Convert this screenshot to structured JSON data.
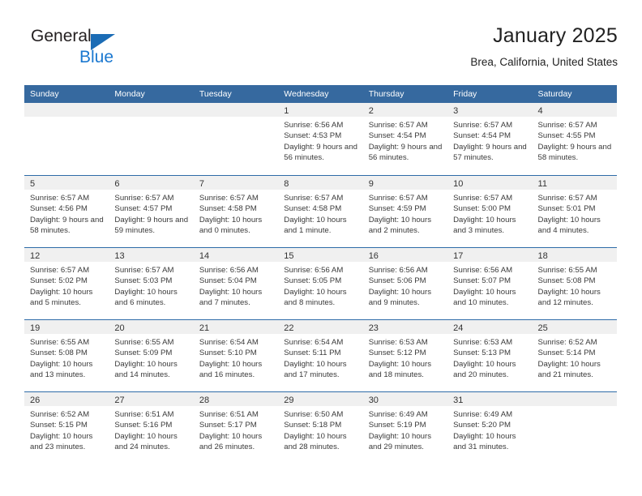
{
  "brand": {
    "name_part1": "General",
    "name_part2": "Blue",
    "accent_color": "#1b6cb5",
    "blue_text_color": "#1b78d0"
  },
  "header": {
    "title": "January 2025",
    "subtitle": "Brea, California, United States",
    "header_bg_color": "#36699f",
    "row_divider_color": "#2e6ca8",
    "day_band_color": "#f0f0f0"
  },
  "weekdays": [
    "Sunday",
    "Monday",
    "Tuesday",
    "Wednesday",
    "Thursday",
    "Friday",
    "Saturday"
  ],
  "weeks": [
    [
      {
        "day": "",
        "sunrise": "",
        "sunset": "",
        "daylight": "",
        "empty": true
      },
      {
        "day": "",
        "sunrise": "",
        "sunset": "",
        "daylight": "",
        "empty": true
      },
      {
        "day": "",
        "sunrise": "",
        "sunset": "",
        "daylight": "",
        "empty": true
      },
      {
        "day": "1",
        "sunrise": "Sunrise: 6:56 AM",
        "sunset": "Sunset: 4:53 PM",
        "daylight": "Daylight: 9 hours and 56 minutes."
      },
      {
        "day": "2",
        "sunrise": "Sunrise: 6:57 AM",
        "sunset": "Sunset: 4:54 PM",
        "daylight": "Daylight: 9 hours and 56 minutes."
      },
      {
        "day": "3",
        "sunrise": "Sunrise: 6:57 AM",
        "sunset": "Sunset: 4:54 PM",
        "daylight": "Daylight: 9 hours and 57 minutes."
      },
      {
        "day": "4",
        "sunrise": "Sunrise: 6:57 AM",
        "sunset": "Sunset: 4:55 PM",
        "daylight": "Daylight: 9 hours and 58 minutes."
      }
    ],
    [
      {
        "day": "5",
        "sunrise": "Sunrise: 6:57 AM",
        "sunset": "Sunset: 4:56 PM",
        "daylight": "Daylight: 9 hours and 58 minutes."
      },
      {
        "day": "6",
        "sunrise": "Sunrise: 6:57 AM",
        "sunset": "Sunset: 4:57 PM",
        "daylight": "Daylight: 9 hours and 59 minutes."
      },
      {
        "day": "7",
        "sunrise": "Sunrise: 6:57 AM",
        "sunset": "Sunset: 4:58 PM",
        "daylight": "Daylight: 10 hours and 0 minutes."
      },
      {
        "day": "8",
        "sunrise": "Sunrise: 6:57 AM",
        "sunset": "Sunset: 4:58 PM",
        "daylight": "Daylight: 10 hours and 1 minute."
      },
      {
        "day": "9",
        "sunrise": "Sunrise: 6:57 AM",
        "sunset": "Sunset: 4:59 PM",
        "daylight": "Daylight: 10 hours and 2 minutes."
      },
      {
        "day": "10",
        "sunrise": "Sunrise: 6:57 AM",
        "sunset": "Sunset: 5:00 PM",
        "daylight": "Daylight: 10 hours and 3 minutes."
      },
      {
        "day": "11",
        "sunrise": "Sunrise: 6:57 AM",
        "sunset": "Sunset: 5:01 PM",
        "daylight": "Daylight: 10 hours and 4 minutes."
      }
    ],
    [
      {
        "day": "12",
        "sunrise": "Sunrise: 6:57 AM",
        "sunset": "Sunset: 5:02 PM",
        "daylight": "Daylight: 10 hours and 5 minutes."
      },
      {
        "day": "13",
        "sunrise": "Sunrise: 6:57 AM",
        "sunset": "Sunset: 5:03 PM",
        "daylight": "Daylight: 10 hours and 6 minutes."
      },
      {
        "day": "14",
        "sunrise": "Sunrise: 6:56 AM",
        "sunset": "Sunset: 5:04 PM",
        "daylight": "Daylight: 10 hours and 7 minutes."
      },
      {
        "day": "15",
        "sunrise": "Sunrise: 6:56 AM",
        "sunset": "Sunset: 5:05 PM",
        "daylight": "Daylight: 10 hours and 8 minutes."
      },
      {
        "day": "16",
        "sunrise": "Sunrise: 6:56 AM",
        "sunset": "Sunset: 5:06 PM",
        "daylight": "Daylight: 10 hours and 9 minutes."
      },
      {
        "day": "17",
        "sunrise": "Sunrise: 6:56 AM",
        "sunset": "Sunset: 5:07 PM",
        "daylight": "Daylight: 10 hours and 10 minutes."
      },
      {
        "day": "18",
        "sunrise": "Sunrise: 6:55 AM",
        "sunset": "Sunset: 5:08 PM",
        "daylight": "Daylight: 10 hours and 12 minutes."
      }
    ],
    [
      {
        "day": "19",
        "sunrise": "Sunrise: 6:55 AM",
        "sunset": "Sunset: 5:08 PM",
        "daylight": "Daylight: 10 hours and 13 minutes."
      },
      {
        "day": "20",
        "sunrise": "Sunrise: 6:55 AM",
        "sunset": "Sunset: 5:09 PM",
        "daylight": "Daylight: 10 hours and 14 minutes."
      },
      {
        "day": "21",
        "sunrise": "Sunrise: 6:54 AM",
        "sunset": "Sunset: 5:10 PM",
        "daylight": "Daylight: 10 hours and 16 minutes."
      },
      {
        "day": "22",
        "sunrise": "Sunrise: 6:54 AM",
        "sunset": "Sunset: 5:11 PM",
        "daylight": "Daylight: 10 hours and 17 minutes."
      },
      {
        "day": "23",
        "sunrise": "Sunrise: 6:53 AM",
        "sunset": "Sunset: 5:12 PM",
        "daylight": "Daylight: 10 hours and 18 minutes."
      },
      {
        "day": "24",
        "sunrise": "Sunrise: 6:53 AM",
        "sunset": "Sunset: 5:13 PM",
        "daylight": "Daylight: 10 hours and 20 minutes."
      },
      {
        "day": "25",
        "sunrise": "Sunrise: 6:52 AM",
        "sunset": "Sunset: 5:14 PM",
        "daylight": "Daylight: 10 hours and 21 minutes."
      }
    ],
    [
      {
        "day": "26",
        "sunrise": "Sunrise: 6:52 AM",
        "sunset": "Sunset: 5:15 PM",
        "daylight": "Daylight: 10 hours and 23 minutes."
      },
      {
        "day": "27",
        "sunrise": "Sunrise: 6:51 AM",
        "sunset": "Sunset: 5:16 PM",
        "daylight": "Daylight: 10 hours and 24 minutes."
      },
      {
        "day": "28",
        "sunrise": "Sunrise: 6:51 AM",
        "sunset": "Sunset: 5:17 PM",
        "daylight": "Daylight: 10 hours and 26 minutes."
      },
      {
        "day": "29",
        "sunrise": "Sunrise: 6:50 AM",
        "sunset": "Sunset: 5:18 PM",
        "daylight": "Daylight: 10 hours and 28 minutes."
      },
      {
        "day": "30",
        "sunrise": "Sunrise: 6:49 AM",
        "sunset": "Sunset: 5:19 PM",
        "daylight": "Daylight: 10 hours and 29 minutes."
      },
      {
        "day": "31",
        "sunrise": "Sunrise: 6:49 AM",
        "sunset": "Sunset: 5:20 PM",
        "daylight": "Daylight: 10 hours and 31 minutes."
      },
      {
        "day": "",
        "sunrise": "",
        "sunset": "",
        "daylight": "",
        "empty": true
      }
    ]
  ]
}
